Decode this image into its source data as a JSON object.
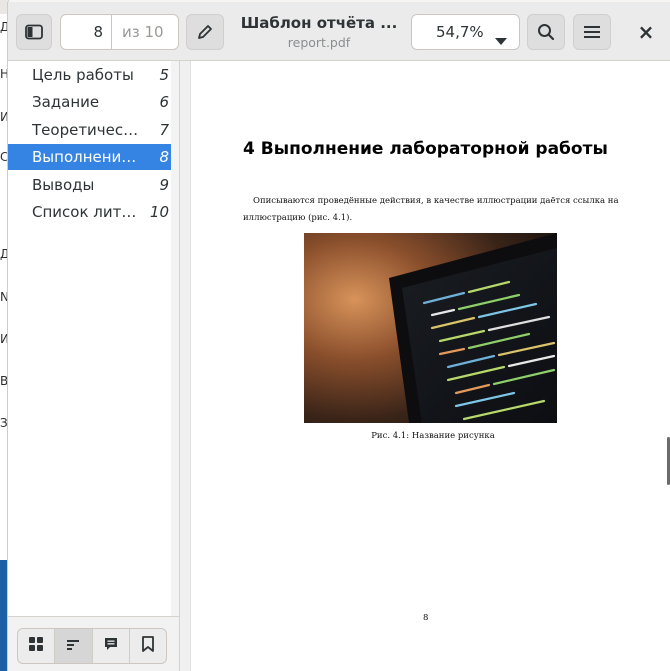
{
  "background_window": {
    "letters": [
      "Д",
      "Н",
      "И",
      "С",
      "Д",
      "N",
      "И",
      "В",
      "З"
    ]
  },
  "header": {
    "sidebar_toggle_icon": "sidebar-show-icon",
    "current_page": "8",
    "page_of": "из 10",
    "annotate_icon": "pencil-icon",
    "title": "Шаблон отчёта ...",
    "subtitle": "report.pdf",
    "zoom": "54,7%",
    "search_icon": "search-icon",
    "menu_icon": "hamburger-menu-icon",
    "close_glyph": "×"
  },
  "sidebar": {
    "items": [
      {
        "label": "Цель работы",
        "page": "5",
        "selected": false
      },
      {
        "label": "Задание",
        "page": "6",
        "selected": false
      },
      {
        "label": "Теоретичес…",
        "page": "7",
        "selected": false
      },
      {
        "label": "Выполнение…",
        "page": "8",
        "selected": true
      },
      {
        "label": "Выводы",
        "page": "9",
        "selected": false
      },
      {
        "label": "Список лите…",
        "page": "10",
        "selected": false
      }
    ],
    "bottom_tabs": [
      "thumbnails-grid-icon",
      "outline-icon",
      "annotations-icon",
      "bookmarks-icon"
    ],
    "active_tab": "outline-icon",
    "selection_color": "#3584e4"
  },
  "document": {
    "section_title": "4  Выполнение лабораторной работы",
    "body_text": "Описываются проведённые действия, в качестве иллюстрации даётся ссылка на иллюстрацию (рис. 4.1).",
    "caption": "Рис. 4.1: Название рисунка",
    "page_number": "8"
  }
}
